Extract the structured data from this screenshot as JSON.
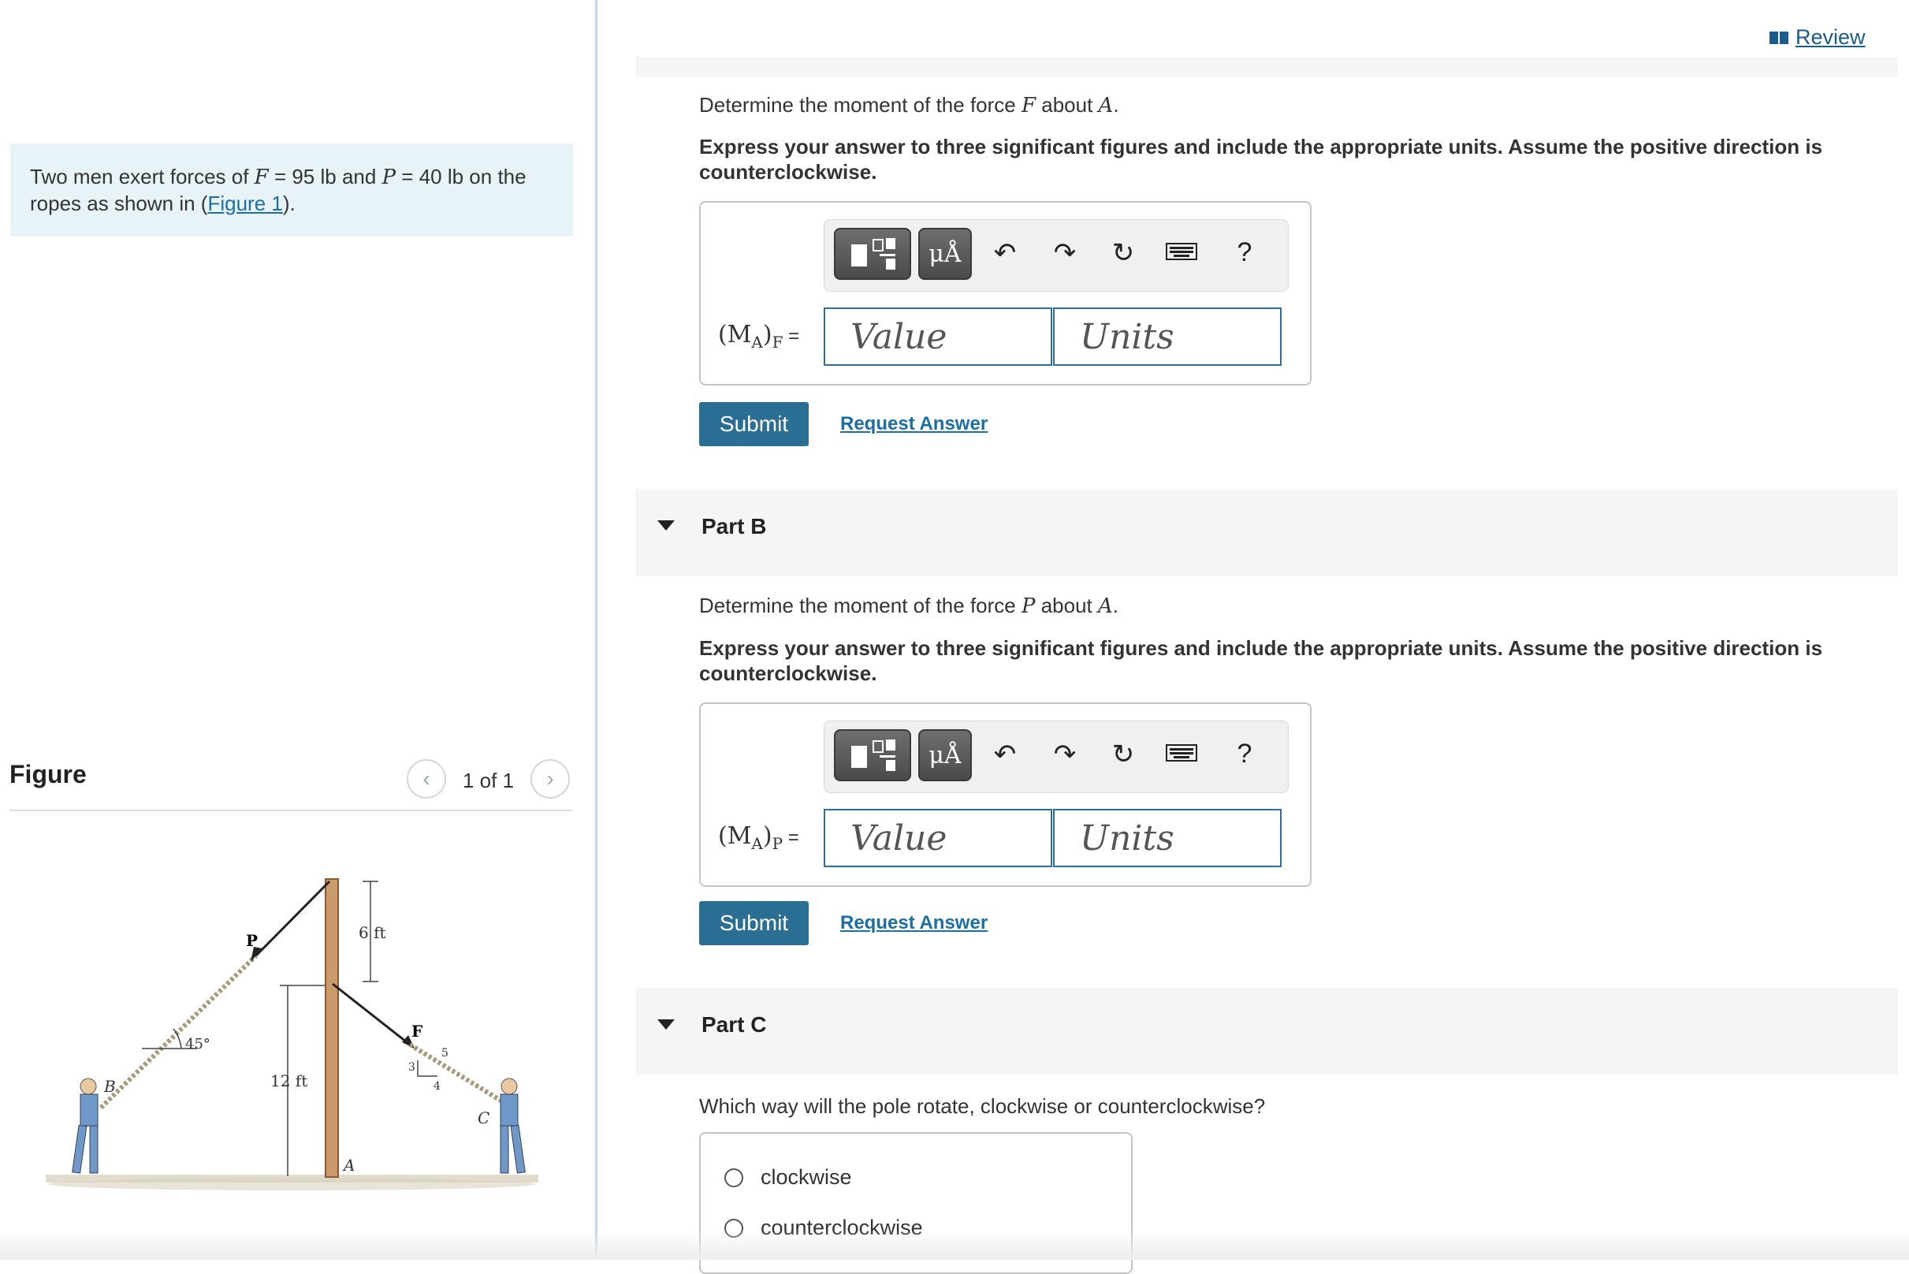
{
  "review": {
    "label": "Review",
    "icon": "book-icon"
  },
  "intro": {
    "prefix": "Two men exert forces of ",
    "F_symbol": "F",
    "F_value": " = 95 lb and ",
    "P_symbol": "P",
    "P_value": " = 40 lb on the ropes as shown in (",
    "figure_link": "Figure 1",
    "suffix": ")."
  },
  "figure": {
    "heading": "Figure",
    "pager": "1 of 1",
    "labels": {
      "P": "P",
      "F": "F",
      "six_ft": "6 ft",
      "twelve_ft": "12 ft",
      "angle": "45°",
      "B": "B",
      "A": "A",
      "C": "C",
      "slope_3": "3",
      "slope_4": "4",
      "slope_5": "5"
    }
  },
  "partA": {
    "question_prefix": "Determine the moment of the force ",
    "question_sym": "F",
    "question_mid": " about ",
    "question_point": "A",
    "question_end": ".",
    "instruction": "Express your answer to three significant figures and include the appropriate units. Assume the positive direction is counterclockwise.",
    "label_main": "(M",
    "label_sub": "A",
    "label_close": ")",
    "label_force": "F",
    "label_eq": " =",
    "value_placeholder": "Value",
    "units_placeholder": "Units",
    "submit": "Submit",
    "request": "Request Answer"
  },
  "partB": {
    "title": "Part B",
    "question_prefix": "Determine the moment of the force ",
    "question_sym": "P",
    "question_mid": " about ",
    "question_point": "A",
    "question_end": ".",
    "instruction": "Express your answer to three significant figures and include the appropriate units. Assume the positive direction is counterclockwise.",
    "label_main": "(M",
    "label_sub": "A",
    "label_close": ")",
    "label_force": "P",
    "label_eq": " =",
    "value_placeholder": "Value",
    "units_placeholder": "Units",
    "submit": "Submit",
    "request": "Request Answer"
  },
  "partC": {
    "title": "Part C",
    "question": "Which way will the pole rotate, clockwise or counterclockwise?",
    "options": [
      "clockwise",
      "counterclockwise"
    ]
  },
  "toolbar": {
    "units_glyph": "μÅ",
    "help": "?",
    "icons": [
      "templates-icon",
      "units-icon",
      "undo-icon",
      "redo-icon",
      "reset-icon",
      "keyboard-icon",
      "help-icon"
    ]
  }
}
